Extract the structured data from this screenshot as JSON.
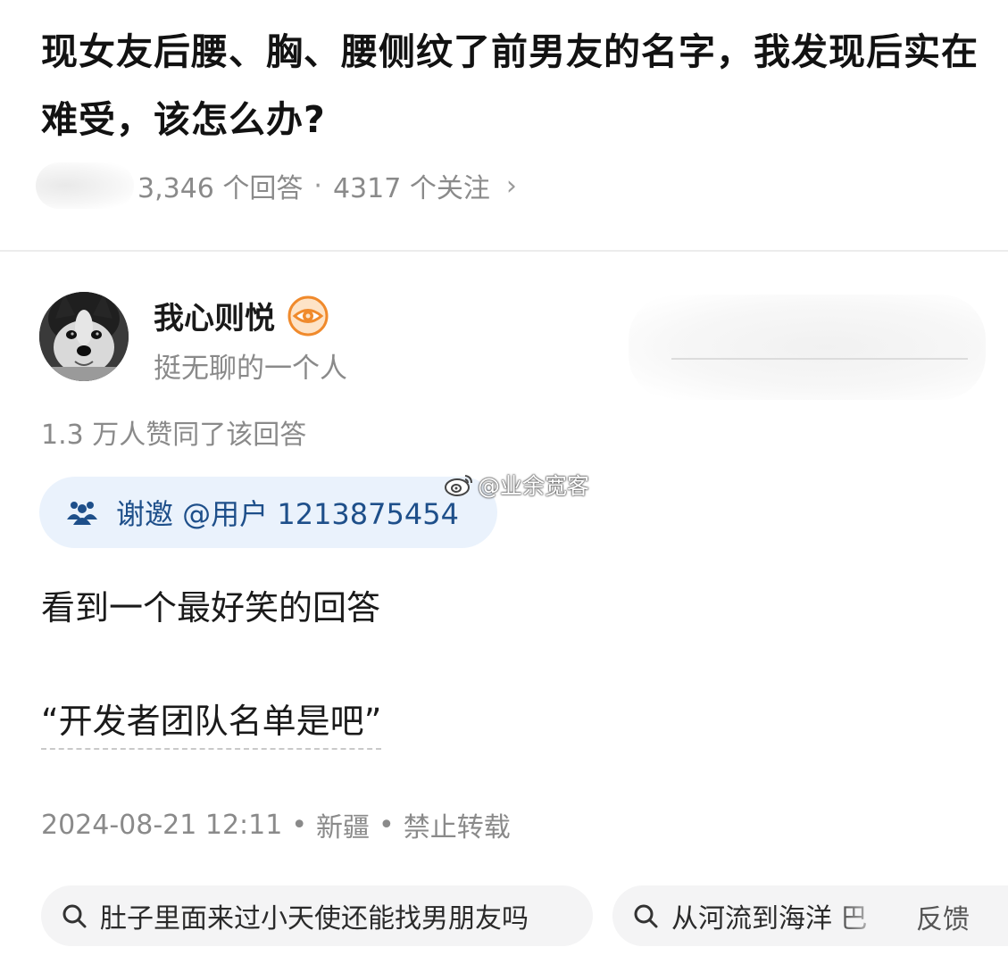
{
  "question": {
    "title": "现女友后腰、胸、腰侧纹了前男友的名字，我发现后实在难受，该怎么办?",
    "answers_count": "3,346 个回答",
    "separator": "·",
    "followers_count": "4317 个关注",
    "chevron": "›"
  },
  "author": {
    "name": "我心则悦",
    "bio": "挺无聊的一个人",
    "badge_icon": "eye-badge-icon",
    "badge_color": "#f08a2c"
  },
  "answer": {
    "votes": "1.3 万人赞同了该回答",
    "invite_text": "谢邀 @用户 1213875454",
    "paragraph_1": "看到一个最好笑的回答",
    "paragraph_2": "“开发者团队名单是吧”",
    "date": "2024-08-21 12:11",
    "separator": "•",
    "location": "新疆",
    "copyright": "禁止转载"
  },
  "watermark": {
    "text": "@业余宽客",
    "icon": "weibo-icon"
  },
  "related": [
    {
      "text": "肚子里面来过小天使还能找男朋友吗"
    },
    {
      "text": "从河流到海洋 巴"
    }
  ],
  "feedback_label": "反馈",
  "colors": {
    "accent_blue": "#1e4f8a",
    "invite_bg": "#eaf2fc",
    "muted_text": "#8a8a8a"
  }
}
